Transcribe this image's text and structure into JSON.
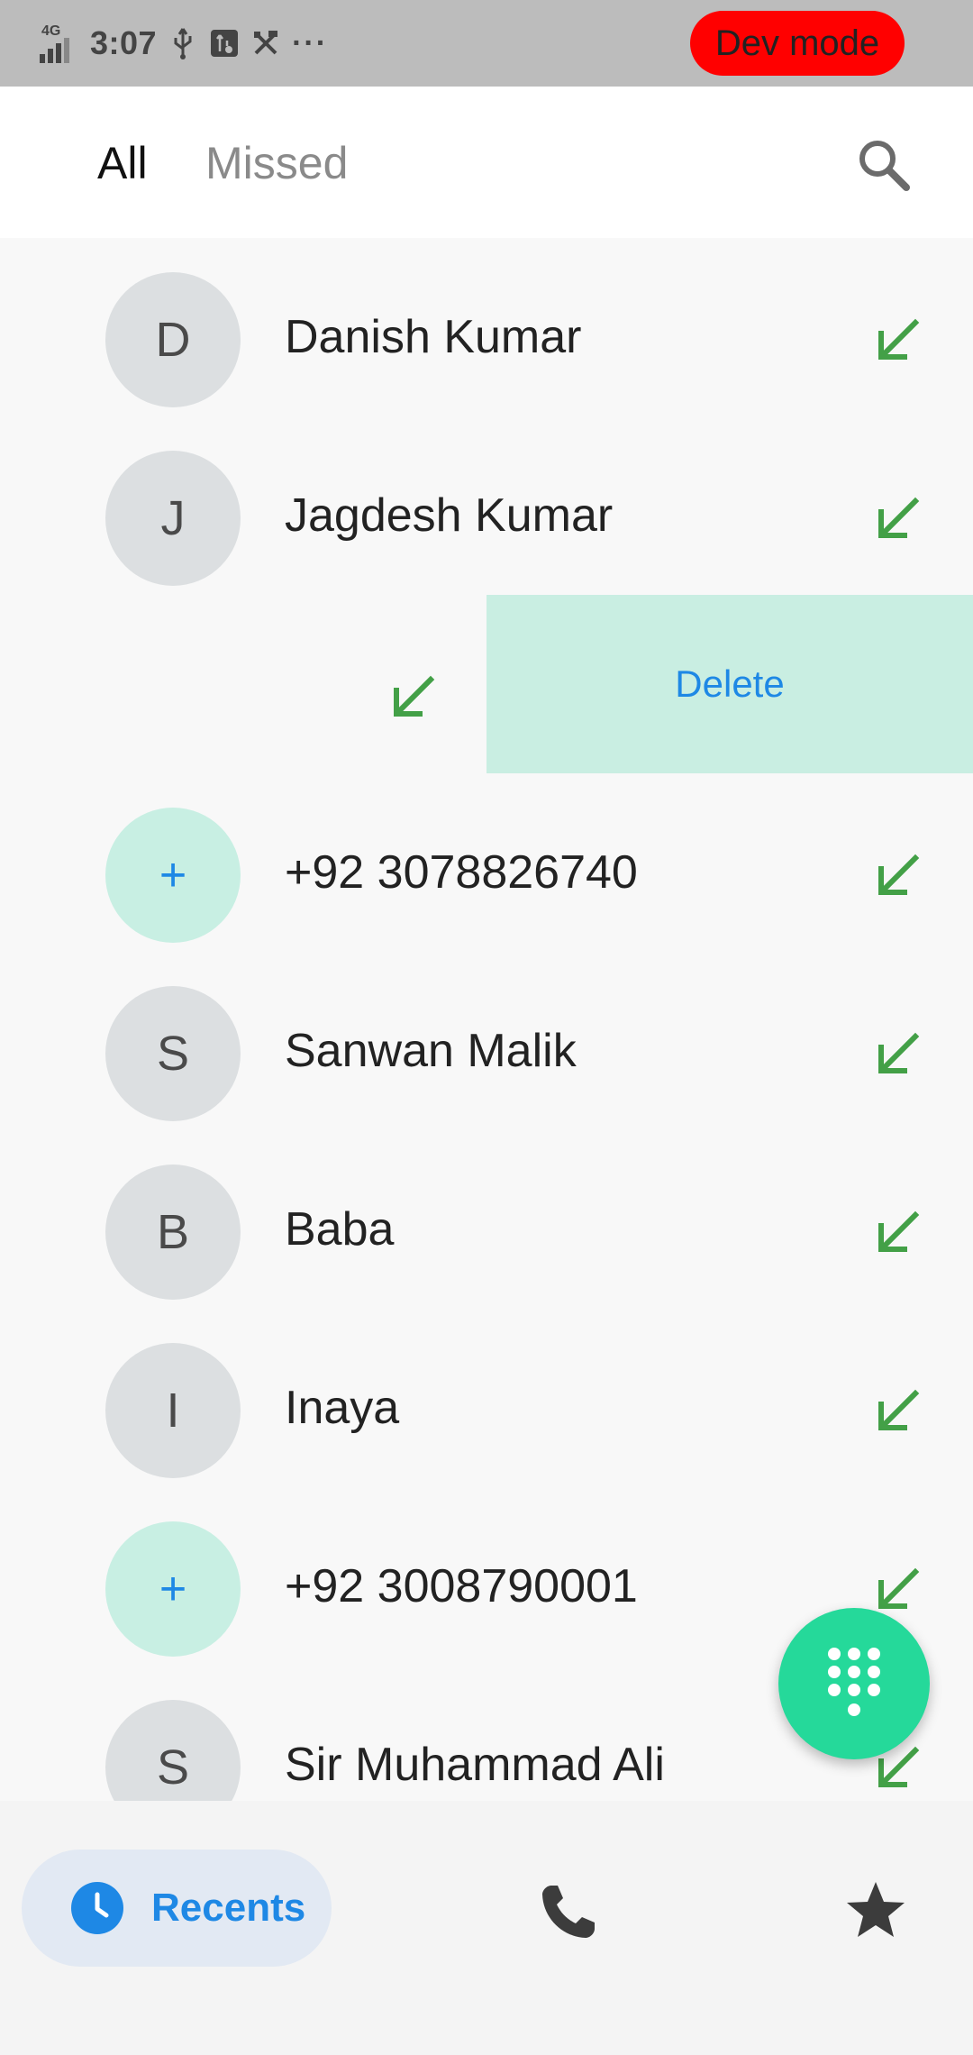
{
  "status_bar": {
    "network": "4G",
    "time": "3:07",
    "icons": [
      "signal-icon",
      "usb-icon",
      "usb-debug-icon",
      "tools-icon"
    ],
    "more": "···",
    "dev_mode": "Dev mode"
  },
  "header": {
    "tabs": [
      {
        "label": "All",
        "selected": true
      },
      {
        "label": "Missed",
        "selected": false
      }
    ],
    "search_icon": "search-icon"
  },
  "calls": [
    {
      "initial": "D",
      "name": "Danish Kumar",
      "type": "incoming"
    },
    {
      "initial": "J",
      "name": "Jagdesh Kumar",
      "type": "incoming"
    },
    {
      "initial": "",
      "name": "",
      "type": "incoming",
      "swiped": true
    },
    {
      "initial": "+",
      "name": "+92 3078826740",
      "type": "incoming"
    },
    {
      "initial": "S",
      "name": "Sanwan Malik",
      "type": "incoming"
    },
    {
      "initial": "B",
      "name": "Baba",
      "type": "incoming"
    },
    {
      "initial": "I",
      "name": "Inaya",
      "type": "incoming"
    },
    {
      "initial": "+",
      "name": "+92 3008790001",
      "type": "incoming"
    },
    {
      "initial": "S",
      "name": "Sir Muhammad Ali",
      "type": "incoming"
    }
  ],
  "swipe_action": {
    "label": "Delete"
  },
  "bottom_nav": {
    "recents_label": "Recents",
    "items": [
      "clock-icon",
      "phone-icon",
      "star-icon"
    ]
  },
  "colors": {
    "accent": "#1e88e5",
    "incoming_arrow": "#43a047",
    "fab": "#25d99a",
    "dev_mode_bg": "#ff0000",
    "delete_bg": "#c9eee2"
  }
}
